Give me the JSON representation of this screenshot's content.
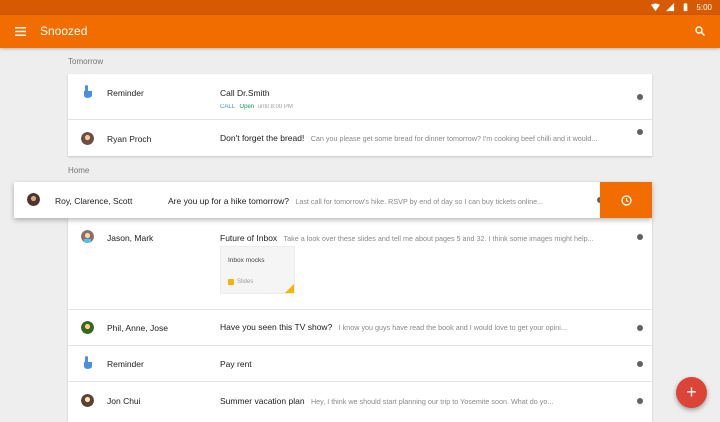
{
  "status_bar": {
    "time": "5:00"
  },
  "app_bar": {
    "title": "Snoozed"
  },
  "sections": {
    "tomorrow": "Tomorrow",
    "home": "Home"
  },
  "tomorrow_items": [
    {
      "sender": "Reminder",
      "subject": "Call Dr.Smith",
      "call_label": "CALL",
      "open_label": "Open",
      "hours_text": "until 8:00 PM"
    },
    {
      "sender": "Ryan Proch",
      "subject": "Don't forget the bread!",
      "snippet": "Can you please get some bread for dinner tomorrow? I'm cooking beef chilli and it would..."
    }
  ],
  "swiped_item": {
    "sender": "Roy, Clarence, Scott",
    "subject": "Are you up for a hike tomorrow?",
    "snippet": "Last call for tomorrow's hike. RSVP by end of day so I can buy tickets online..."
  },
  "home_items": [
    {
      "sender": "Jason, Mark",
      "subject": "Future of Inbox",
      "snippet": "Take a look over these slides and tell me about pages 5 and 32. I think some images might help...",
      "attachment_title": "Inbox mocks",
      "attachment_type": "Slides"
    },
    {
      "sender": "Phil, Anne, Jose",
      "subject": "Have you seen this TV show?",
      "snippet": "I know you guys have read the book and I would love to get your opini..."
    },
    {
      "sender": "Reminder",
      "subject": "Pay rent",
      "snippet": ""
    },
    {
      "sender": "Jon Chui",
      "subject": "Summer vacation plan",
      "snippet": "Hey, I think we should start planning our trip to Yosemite soon. What do yo..."
    }
  ],
  "fab": {
    "label": "+"
  },
  "colors": {
    "accent": "#f26d00",
    "status_bar": "#d85a00",
    "fab": "#db4437",
    "reminder_hand": "#4a90e2",
    "attachment": "#f4b400"
  }
}
